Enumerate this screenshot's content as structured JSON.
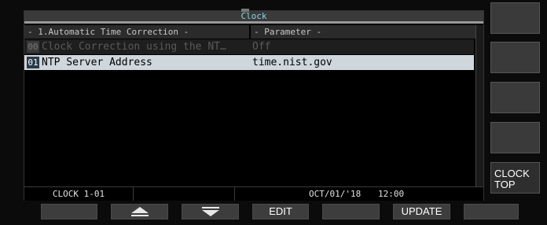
{
  "window": {
    "title": "Clock"
  },
  "columns": {
    "item": "- 1.Automatic Time Correction -",
    "parameter": "- Parameter -"
  },
  "rows": [
    {
      "num": "00",
      "name": "Clock Correction using the NT…",
      "value": "Off",
      "state": "disabled"
    },
    {
      "num": "01",
      "name": "NTP Server Address",
      "value": "time.nist.gov",
      "state": "selected"
    }
  ],
  "status": {
    "page": "CLOCK 1-01",
    "date": "OCT/01/'18",
    "time": "12:00"
  },
  "side_keys": {
    "clock_top_line1": "CLOCK",
    "clock_top_line2": "TOP"
  },
  "bottom_keys": {
    "up": "up-arrow-icon",
    "down": "down-arrow-icon",
    "edit": "EDIT",
    "update": "UPDATE"
  },
  "colors": {
    "selected_row": "#cfd6dc",
    "title_text": "#8fd3e0"
  }
}
